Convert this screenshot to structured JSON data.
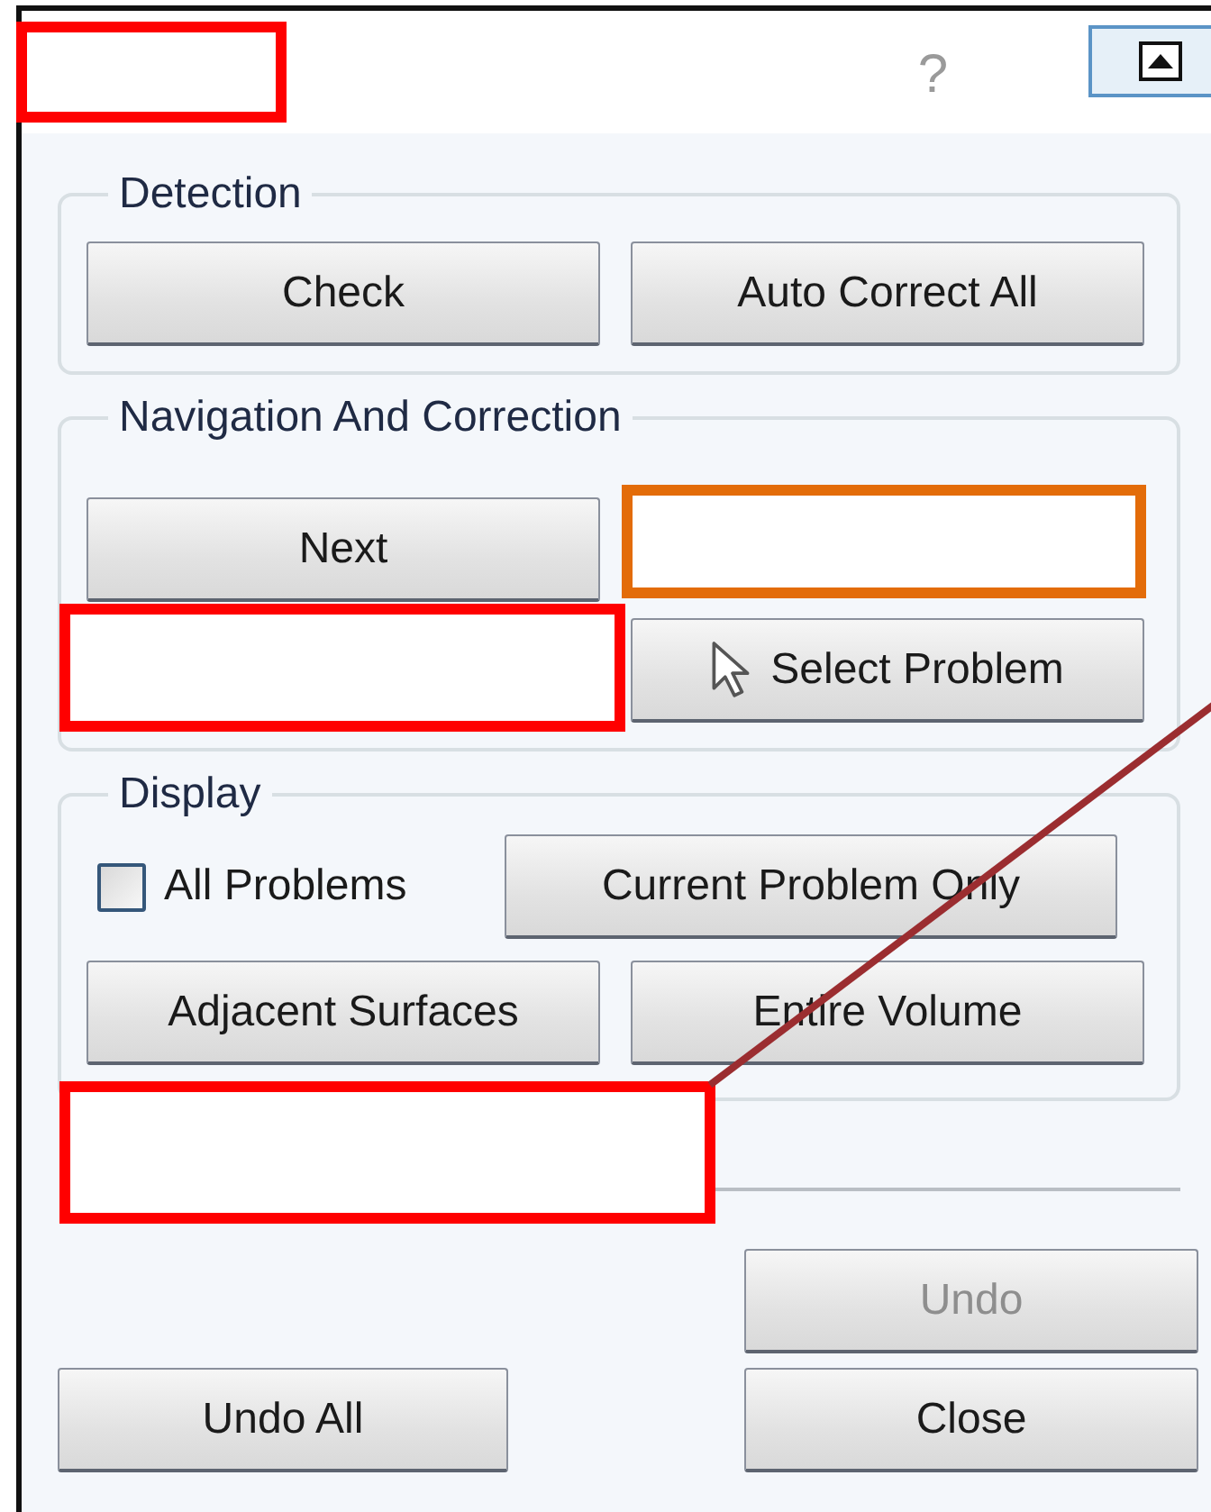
{
  "title_bar": {
    "help": "?"
  },
  "groups": [
    {
      "title": "Detection",
      "rows": [
        [
          {
            "kind": "button",
            "label": "Check",
            "disabled": false
          },
          {
            "kind": "button",
            "label": "Auto Correct All",
            "disabled": false
          }
        ]
      ]
    },
    {
      "title": "Navigation And Correction",
      "rows": [
        [
          {
            "kind": "button",
            "label": "Next",
            "disabled": false
          },
          {
            "kind": "covered"
          }
        ],
        [
          {
            "kind": "covered"
          },
          {
            "kind": "icon_button",
            "label": "Select Problem",
            "disabled": false
          }
        ]
      ]
    },
    {
      "title": "Display",
      "rows": [
        [
          {
            "kind": "checkbox",
            "label": "All Problems",
            "checked": false
          },
          {
            "kind": "button",
            "label": "Current Problem Only",
            "disabled": false
          }
        ],
        [
          {
            "kind": "button",
            "label": "Adjacent Surfaces",
            "disabled": false
          },
          {
            "kind": "button",
            "label": "Entire Volume",
            "disabled": false
          }
        ]
      ]
    }
  ],
  "footer": {
    "undo": {
      "label": "Undo",
      "disabled": true
    },
    "undo_all": {
      "label": "Undo All",
      "disabled": false
    },
    "close": {
      "label": "Close",
      "disabled": false
    }
  },
  "annotations": [
    {
      "kind": "box",
      "color": "#ff0000"
    },
    {
      "kind": "box",
      "color": "#e36c09"
    },
    {
      "kind": "box",
      "color": "#ff0000"
    },
    {
      "kind": "box",
      "color": "#ff0000"
    },
    {
      "kind": "line",
      "color": "#9b2d30"
    }
  ]
}
